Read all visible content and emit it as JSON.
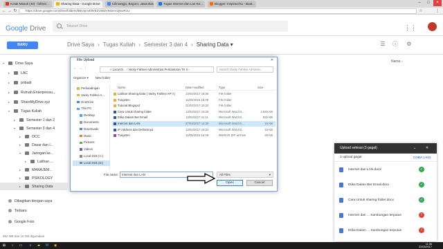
{
  "browser": {
    "tabs": [
      "Kotak Masuk (40) - fahlevi...",
      "Sharing Data - Google Drive",
      "Cilimangjo, Bogoro, Jawa Bara...",
      "Tugas Internet dan Lan Ke...",
      "Blogger: Inspirasi-ku - Buat..."
    ],
    "url": "https://drive.google.com/drive/folders/0Bv4ym4NVEZUWZV9sbnV2jNwR1U"
  },
  "drive": {
    "logo_google": "Google",
    "logo_drive": "Drive",
    "search_placeholder": "Telusuri Drive",
    "new_button": "BARU",
    "breadcrumb": [
      "Drive Saya",
      "›",
      "Tugas Kuliah",
      "›",
      "Semester 3 dan 4",
      "›",
      "Sharing Data ▾"
    ],
    "name_header": "Nama",
    "storage": "692 MB dari 15 GB digunakan"
  },
  "sidebar": [
    {
      "label": "Drive Saya",
      "indent": 0,
      "arrow": "▾",
      "sel": false
    },
    {
      "label": "LAC",
      "indent": 1,
      "arrow": "▸",
      "sel": false
    },
    {
      "label": "pribadi",
      "indent": 1,
      "arrow": "▸",
      "sel": false
    },
    {
      "label": "Rumah Enterpressu...",
      "indent": 1,
      "arrow": "▸",
      "sel": false
    },
    {
      "label": "ShareMyDrive.xyz",
      "indent": 1,
      "arrow": "▸",
      "sel": false
    },
    {
      "label": "Tugas Kuliah",
      "indent": 1,
      "arrow": "▾",
      "sel": false
    },
    {
      "label": "Semester 1 dan 2",
      "indent": 2,
      "arrow": "▸",
      "sel": false
    },
    {
      "label": "Semester 3 dan 4",
      "indent": 2,
      "arrow": "▾",
      "sel": false
    },
    {
      "label": "OCC",
      "indent": 3,
      "arrow": "▸",
      "sel": false
    },
    {
      "label": "Dasar dan l...",
      "indent": 3,
      "arrow": "▸",
      "sel": false
    },
    {
      "label": "Jaringan ke...",
      "indent": 3,
      "arrow": "▾",
      "sel": false
    },
    {
      "label": "Latihan ...",
      "indent": 4,
      "arrow": "▸",
      "sel": false
    },
    {
      "label": "MANAJEM...",
      "indent": 3,
      "arrow": "▸",
      "sel": false
    },
    {
      "label": "PSIKOLOGY",
      "indent": 3,
      "arrow": "▸",
      "sel": false
    },
    {
      "label": "Sharing Data",
      "indent": 3,
      "arrow": "▸",
      "sel": true
    },
    {
      "label": "Dibagikan dengan saya",
      "indent": 0,
      "arrow": "",
      "sel": false
    },
    {
      "label": "Terbaru",
      "indent": 0,
      "arrow": "",
      "sel": false
    },
    {
      "label": "Google Foto",
      "indent": 0,
      "arrow": "",
      "sel": false
    }
  ],
  "dialog": {
    "title": "File Upload",
    "path": "« Local Di... › Vacky Fahlevi Administrasi Perkantoran TK II ›",
    "search_placeholder": "Search Vacky Fahlevi Administ...",
    "organize": "Organize ▾",
    "new_folder": "New folder",
    "columns": {
      "name": "Name",
      "date": "Date modified",
      "type": "Type",
      "size": "Size"
    },
    "nav": [
      "Perbandingan",
      "Vacky Fahlevi A...",
      "OneDrive",
      "This PC",
      "Desktop",
      "Documents",
      "Downloads",
      "Music",
      "Pictures",
      "Videos",
      "Local Disk (C:)",
      "Local Disk (D:)"
    ],
    "files": [
      {
        "name": "Latihan Sharing Data ( Vacky Fahlevi AP II )",
        "date": "13/02/2017 15:26",
        "type": "File folder",
        "size": "",
        "sel": false
      },
      {
        "name": "Tungsten",
        "date": "11/03/2016 15:09",
        "type": "File folder",
        "size": "",
        "sel": false
      },
      {
        "name": "Tutorial Blogspot",
        "date": "21/02/2017 15:20",
        "type": "File folder",
        "size": "",
        "sel": false
      },
      {
        "name": "Cara Untuk sharing folder",
        "date": "13/02/2017 15:26",
        "type": "Microsoft Word D...",
        "size": "2.945 KB",
        "sel": false
      },
      {
        "name": "Etika Dalam Ber Email",
        "date": "13/02/2017 11:11",
        "type": "Microsoft Word D...",
        "size": "832 KB",
        "sel": false
      },
      {
        "name": "Internet dan LAN",
        "date": "27/02/2017 14:30",
        "type": "Microsoft Word D...",
        "size": "15 KB",
        "sel": true
      },
      {
        "name": "IP Address dan Definisinya",
        "date": "13/02/2017 16:22",
        "type": "Microsoft Word D...",
        "size": "15 KB",
        "sel": false
      },
      {
        "name": "Tungsten",
        "date": "11/03/2016 15:09",
        "type": "WinRAR ZIP archive",
        "size": "46 KB",
        "sel": false
      }
    ],
    "filename_label": "File name:",
    "filename_value": "Internet dan LAN",
    "filetype": "All Files",
    "open": "Open",
    "cancel": "Cancel"
  },
  "upload": {
    "title": "Upload selesai (3 gagal)",
    "subtitle": "3 upload gagal",
    "retry": "COBA LAGI",
    "rows": [
      {
        "name": "Internet dan LAN.docx",
        "status": "ok"
      },
      {
        "name": "Etika Dalam Ber Email.docx",
        "status": "ok"
      },
      {
        "name": "Cara Untuk sharing folder.docx",
        "status": "ok"
      },
      {
        "name": "Internet dan ...   Sambungan terputus",
        "status": "fail"
      },
      {
        "name": "Etika Dalam ...   Sambungan terputus",
        "status": "fail"
      }
    ]
  },
  "clock": {
    "time": "11:36",
    "date": "22/03/2017"
  },
  "colors": {
    "accent": "#4285f4",
    "ok": "#34a853",
    "fail": "#db4437"
  }
}
